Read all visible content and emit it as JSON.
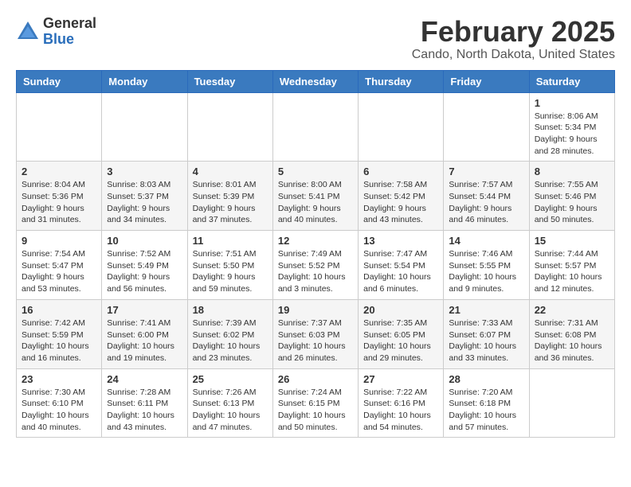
{
  "logo": {
    "general": "General",
    "blue": "Blue"
  },
  "header": {
    "month": "February 2025",
    "location": "Cando, North Dakota, United States"
  },
  "days_of_week": [
    "Sunday",
    "Monday",
    "Tuesday",
    "Wednesday",
    "Thursday",
    "Friday",
    "Saturday"
  ],
  "weeks": [
    [
      {
        "day": "",
        "info": ""
      },
      {
        "day": "",
        "info": ""
      },
      {
        "day": "",
        "info": ""
      },
      {
        "day": "",
        "info": ""
      },
      {
        "day": "",
        "info": ""
      },
      {
        "day": "",
        "info": ""
      },
      {
        "day": "1",
        "info": "Sunrise: 8:06 AM\nSunset: 5:34 PM\nDaylight: 9 hours and 28 minutes."
      }
    ],
    [
      {
        "day": "2",
        "info": "Sunrise: 8:04 AM\nSunset: 5:36 PM\nDaylight: 9 hours and 31 minutes."
      },
      {
        "day": "3",
        "info": "Sunrise: 8:03 AM\nSunset: 5:37 PM\nDaylight: 9 hours and 34 minutes."
      },
      {
        "day": "4",
        "info": "Sunrise: 8:01 AM\nSunset: 5:39 PM\nDaylight: 9 hours and 37 minutes."
      },
      {
        "day": "5",
        "info": "Sunrise: 8:00 AM\nSunset: 5:41 PM\nDaylight: 9 hours and 40 minutes."
      },
      {
        "day": "6",
        "info": "Sunrise: 7:58 AM\nSunset: 5:42 PM\nDaylight: 9 hours and 43 minutes."
      },
      {
        "day": "7",
        "info": "Sunrise: 7:57 AM\nSunset: 5:44 PM\nDaylight: 9 hours and 46 minutes."
      },
      {
        "day": "8",
        "info": "Sunrise: 7:55 AM\nSunset: 5:46 PM\nDaylight: 9 hours and 50 minutes."
      }
    ],
    [
      {
        "day": "9",
        "info": "Sunrise: 7:54 AM\nSunset: 5:47 PM\nDaylight: 9 hours and 53 minutes."
      },
      {
        "day": "10",
        "info": "Sunrise: 7:52 AM\nSunset: 5:49 PM\nDaylight: 9 hours and 56 minutes."
      },
      {
        "day": "11",
        "info": "Sunrise: 7:51 AM\nSunset: 5:50 PM\nDaylight: 9 hours and 59 minutes."
      },
      {
        "day": "12",
        "info": "Sunrise: 7:49 AM\nSunset: 5:52 PM\nDaylight: 10 hours and 3 minutes."
      },
      {
        "day": "13",
        "info": "Sunrise: 7:47 AM\nSunset: 5:54 PM\nDaylight: 10 hours and 6 minutes."
      },
      {
        "day": "14",
        "info": "Sunrise: 7:46 AM\nSunset: 5:55 PM\nDaylight: 10 hours and 9 minutes."
      },
      {
        "day": "15",
        "info": "Sunrise: 7:44 AM\nSunset: 5:57 PM\nDaylight: 10 hours and 12 minutes."
      }
    ],
    [
      {
        "day": "16",
        "info": "Sunrise: 7:42 AM\nSunset: 5:59 PM\nDaylight: 10 hours and 16 minutes."
      },
      {
        "day": "17",
        "info": "Sunrise: 7:41 AM\nSunset: 6:00 PM\nDaylight: 10 hours and 19 minutes."
      },
      {
        "day": "18",
        "info": "Sunrise: 7:39 AM\nSunset: 6:02 PM\nDaylight: 10 hours and 23 minutes."
      },
      {
        "day": "19",
        "info": "Sunrise: 7:37 AM\nSunset: 6:03 PM\nDaylight: 10 hours and 26 minutes."
      },
      {
        "day": "20",
        "info": "Sunrise: 7:35 AM\nSunset: 6:05 PM\nDaylight: 10 hours and 29 minutes."
      },
      {
        "day": "21",
        "info": "Sunrise: 7:33 AM\nSunset: 6:07 PM\nDaylight: 10 hours and 33 minutes."
      },
      {
        "day": "22",
        "info": "Sunrise: 7:31 AM\nSunset: 6:08 PM\nDaylight: 10 hours and 36 minutes."
      }
    ],
    [
      {
        "day": "23",
        "info": "Sunrise: 7:30 AM\nSunset: 6:10 PM\nDaylight: 10 hours and 40 minutes."
      },
      {
        "day": "24",
        "info": "Sunrise: 7:28 AM\nSunset: 6:11 PM\nDaylight: 10 hours and 43 minutes."
      },
      {
        "day": "25",
        "info": "Sunrise: 7:26 AM\nSunset: 6:13 PM\nDaylight: 10 hours and 47 minutes."
      },
      {
        "day": "26",
        "info": "Sunrise: 7:24 AM\nSunset: 6:15 PM\nDaylight: 10 hours and 50 minutes."
      },
      {
        "day": "27",
        "info": "Sunrise: 7:22 AM\nSunset: 6:16 PM\nDaylight: 10 hours and 54 minutes."
      },
      {
        "day": "28",
        "info": "Sunrise: 7:20 AM\nSunset: 6:18 PM\nDaylight: 10 hours and 57 minutes."
      },
      {
        "day": "",
        "info": ""
      }
    ]
  ]
}
